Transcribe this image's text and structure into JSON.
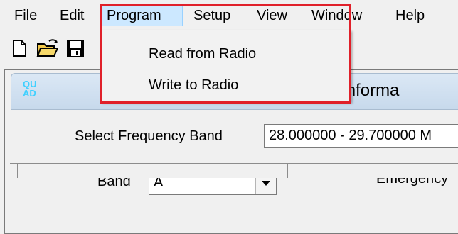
{
  "menubar": {
    "items": [
      {
        "label": "File"
      },
      {
        "label": "Edit"
      },
      {
        "label": "Program"
      },
      {
        "label": "Setup"
      },
      {
        "label": "View"
      },
      {
        "label": "Window"
      },
      {
        "label": "Help"
      }
    ]
  },
  "program_menu": {
    "items": [
      {
        "label": "Read from Radio"
      },
      {
        "label": "Write to Radio"
      }
    ]
  },
  "child_window": {
    "title": "nnel Informa",
    "logo": "QU\nAD"
  },
  "form": {
    "select_band_label": "Select Frequency Band",
    "select_band_value": "28.000000 - 29.700000 M",
    "band_label": "Band",
    "band_value": "A",
    "emergency_label": "Emergency"
  },
  "colors": {
    "highlight_border": "#e0202a",
    "menu_active_bg": "#cce8ff",
    "logo_color": "#3fd0ff"
  },
  "icons": [
    "new-document-icon",
    "open-folder-icon",
    "save-icon",
    "combo-arrow-icon"
  ]
}
